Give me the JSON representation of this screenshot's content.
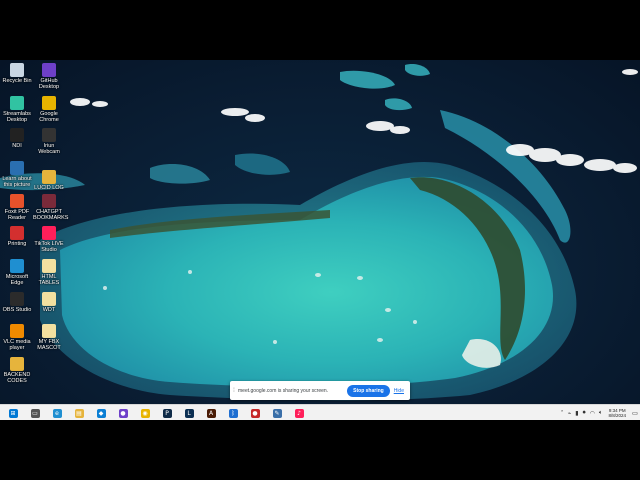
{
  "desktop_icons": [
    {
      "label": "Recycle Bin",
      "icon": "recycle-bin-icon",
      "color": "#c9d6e3"
    },
    {
      "label": "GitHub\nDesktop",
      "icon": "github-icon",
      "color": "#6e40c9"
    },
    {
      "label": "Streamlabs\nDesktop",
      "icon": "streamlabs-icon",
      "color": "#31c3a2"
    },
    {
      "label": "Google\nChrome",
      "icon": "chrome-icon",
      "color": "#e8b400"
    },
    {
      "label": "NDI",
      "icon": "ndi-icon",
      "color": "#222222"
    },
    {
      "label": "Iriun\nWebcam",
      "icon": "webcam-icon",
      "color": "#333333"
    },
    {
      "label": "Learn about\nthis picture",
      "icon": "camera-icon",
      "color": "#2a6fb0"
    },
    {
      "label": "LUCID LOG",
      "icon": "folder-icon",
      "color": "#e6b43c"
    },
    {
      "label": "Foxit PDF\nReader",
      "icon": "foxit-icon",
      "color": "#e8522b"
    },
    {
      "label": "CHATGPT\nBOOKMARKS",
      "icon": "bookmark-icon",
      "color": "#7a2a3a"
    },
    {
      "label": "Printing",
      "icon": "printing-icon",
      "color": "#d32f2f"
    },
    {
      "label": "TikTok LIVE\nStudio",
      "icon": "tiktok-icon",
      "color": "#ff1f5a"
    },
    {
      "label": "Microsoft\nEdge",
      "icon": "edge-icon",
      "color": "#1f8fd1"
    },
    {
      "label": "HTML\nTABLES",
      "icon": "file-icon",
      "color": "#f3e0a0"
    },
    {
      "label": "OBS Studio",
      "icon": "obs-icon",
      "color": "#2b2b2b"
    },
    {
      "label": "WDT",
      "icon": "file-icon",
      "color": "#f3e0a0"
    },
    {
      "label": "VLC media\nplayer",
      "icon": "vlc-icon",
      "color": "#f08a00"
    },
    {
      "label": "MY FBX\nMASCOT",
      "icon": "file-icon",
      "color": "#f3e0a0"
    },
    {
      "label": "BACKEND\nCODES",
      "icon": "folder-icon",
      "color": "#e6b43c"
    }
  ],
  "share_banner": {
    "message": "meet.google.com is sharing your screen.",
    "stop_label": "Stop sharing",
    "hide_label": "Hide"
  },
  "taskbar": {
    "apps": [
      {
        "name": "start-icon",
        "glyph": "⊞",
        "color": "#0078d4"
      },
      {
        "name": "task-view-icon",
        "glyph": "▭",
        "color": "#555555"
      },
      {
        "name": "edge-icon",
        "glyph": "e",
        "color": "#1f8fd1"
      },
      {
        "name": "file-explorer-icon",
        "glyph": "▤",
        "color": "#e6b43c"
      },
      {
        "name": "vscode-icon",
        "glyph": "◆",
        "color": "#0b7fd4"
      },
      {
        "name": "github-icon",
        "glyph": "●",
        "color": "#6e40c9"
      },
      {
        "name": "chrome-icon",
        "glyph": "◉",
        "color": "#e8b400"
      },
      {
        "name": "photoshop-icon",
        "glyph": "P",
        "color": "#0e2a47"
      },
      {
        "name": "lightroom-icon",
        "glyph": "L",
        "color": "#0b2f52"
      },
      {
        "name": "illustrator-icon",
        "glyph": "A",
        "color": "#4a1c06"
      },
      {
        "name": "bluetooth-icon",
        "glyph": "ᛒ",
        "color": "#1f6fd1"
      },
      {
        "name": "recorder-icon",
        "glyph": "●",
        "color": "#c62828"
      },
      {
        "name": "paint-icon",
        "glyph": "✎",
        "color": "#3a6fa8"
      },
      {
        "name": "tiktok-icon",
        "glyph": "♪",
        "color": "#ff1f5a"
      }
    ],
    "tray": {
      "time": "9:34 PM",
      "date": "8/8/2024"
    }
  }
}
